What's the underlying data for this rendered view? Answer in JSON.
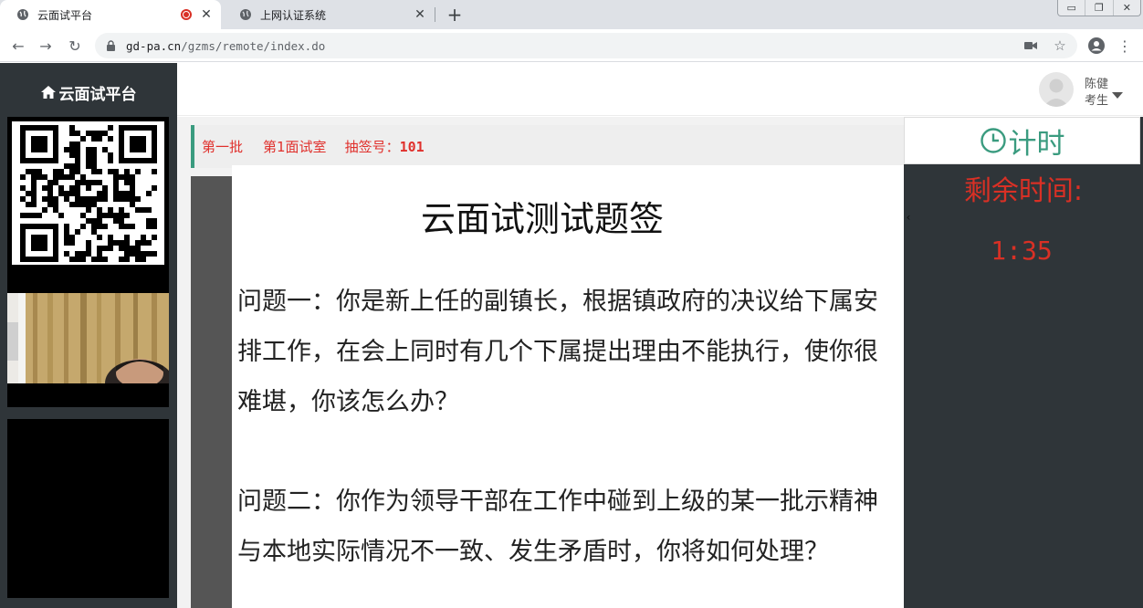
{
  "browser": {
    "tabs": [
      {
        "title": "云面试平台",
        "active": true,
        "recording": true
      },
      {
        "title": "上网认证系统",
        "active": false
      }
    ],
    "url": {
      "host": "gd-pa.cn",
      "path": "/gzms/remote/index.do"
    }
  },
  "app": {
    "brand": "云面试平台",
    "user": {
      "name": "陈健",
      "role": "考生"
    }
  },
  "exam": {
    "batch": "第一批",
    "room": "第1面试室",
    "draw_label": "抽签号：",
    "draw_number": "101"
  },
  "question_sheet": {
    "title": "云面试测试题签",
    "questions": [
      "问题一：你是新上任的副镇长，根据镇政府的决议给下属安排工作，在会上同时有几个下属提出理由不能执行，使你很难堪，你该怎么办？",
      "问题二：你作为领导干部在工作中碰到上级的某一批示精神与本地实际情况不一致、发生矛盾时，你将如何处理？"
    ]
  },
  "timer": {
    "header": "计时",
    "label": "剩余时间:",
    "remaining": "1:35"
  },
  "colors": {
    "accent_green": "#3a9b7f",
    "alert_red": "#d93025",
    "sidebar_dark": "#2f3539"
  },
  "icons": {
    "brand": "home-icon",
    "timer": "clock-icon"
  }
}
